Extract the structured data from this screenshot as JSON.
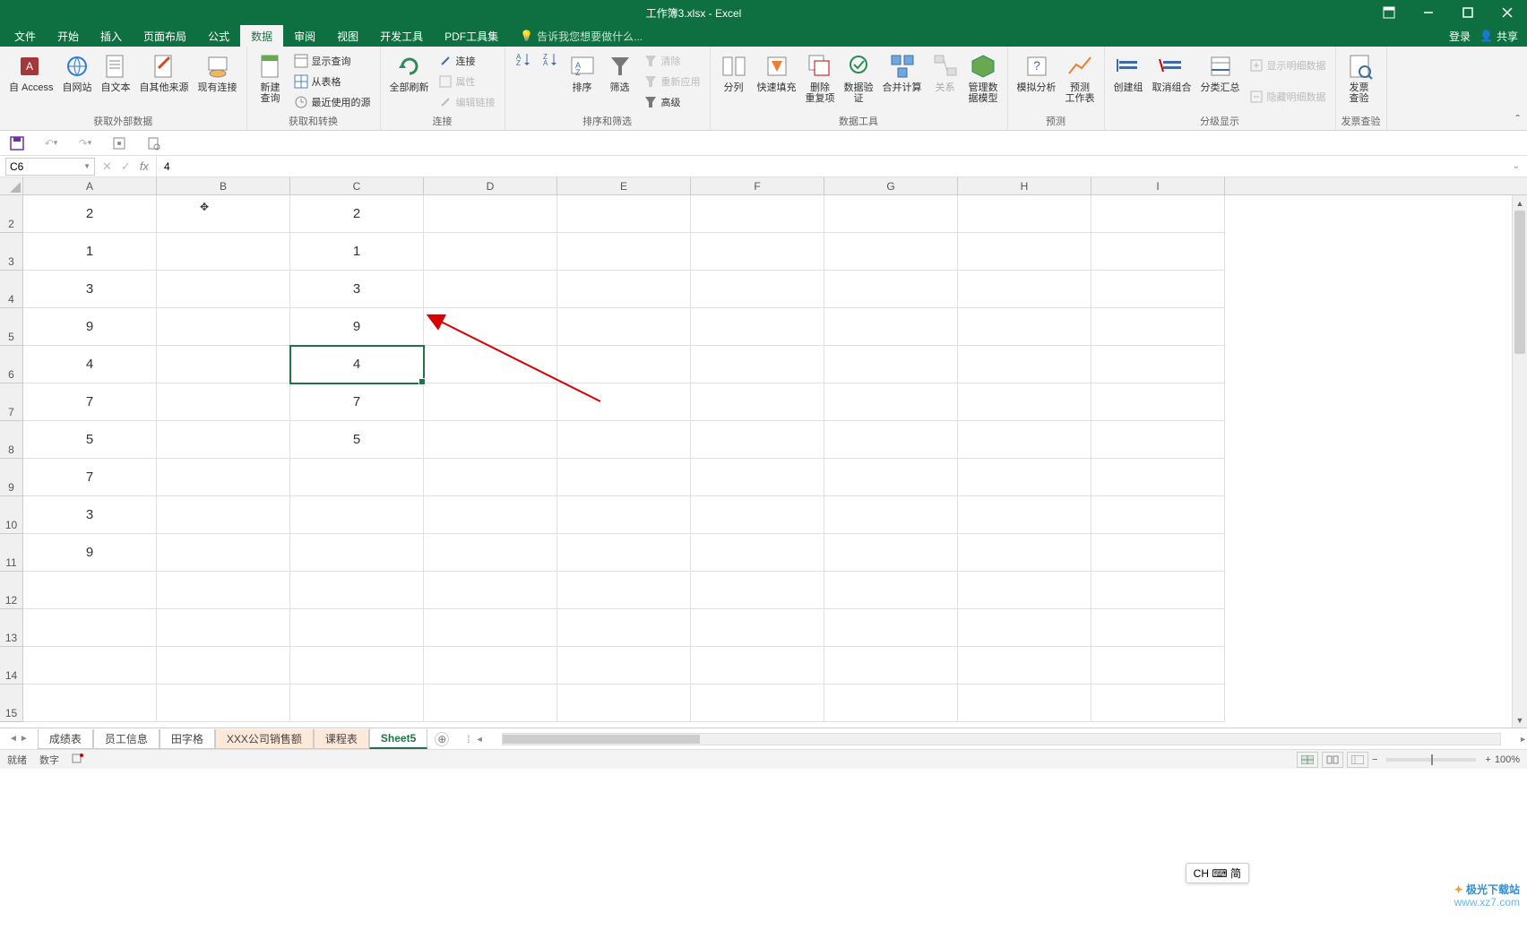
{
  "app": {
    "title": "工作簿3.xlsx - Excel"
  },
  "winctl": {
    "ribbonopts": "⧉",
    "min": "—",
    "max": "□",
    "close": "✕"
  },
  "menu": {
    "tabs": [
      "文件",
      "开始",
      "插入",
      "页面布局",
      "公式",
      "数据",
      "审阅",
      "视图",
      "开发工具",
      "PDF工具集"
    ],
    "active": 5,
    "tellme": "告诉我您想要做什么...",
    "login": "登录",
    "share": "共享"
  },
  "ribbon": {
    "groups": {
      "external": {
        "label": "获取外部数据",
        "access": "自 Access",
        "web": "自网站",
        "text": "自文本",
        "other": "自其他来源",
        "existing": "现有连接"
      },
      "transform": {
        "label": "获取和转换",
        "newq": "新建\n查询",
        "showq": "显示查询",
        "fromtable": "从表格",
        "recent": "最近使用的源"
      },
      "conn": {
        "label": "连接",
        "refresh": "全部刷新",
        "connections": "连接",
        "props": "属性",
        "editlinks": "编辑链接"
      },
      "sort": {
        "label": "排序和筛选",
        "sort": "排序",
        "filter": "筛选",
        "clear": "清除",
        "reapply": "重新应用",
        "adv": "高级"
      },
      "tools": {
        "label": "数据工具",
        "t2c": "分列",
        "flash": "快速填充",
        "dedup": "删除\n重复项",
        "validate": "数据验\n证",
        "consolidate": "合并计算",
        "relations": "关系",
        "manage": "管理数\n据模型"
      },
      "forecast": {
        "label": "预测",
        "whatif": "模拟分析",
        "sheet": "预测\n工作表"
      },
      "outline": {
        "label": "分级显示",
        "group": "创建组",
        "ungroup": "取消组合",
        "subtotal": "分类汇总",
        "showdetail": "显示明细数据",
        "hidedetail": "隐藏明细数据"
      },
      "invoice": {
        "label": "发票查验",
        "btn": "发票\n查验"
      }
    }
  },
  "fbar": {
    "name": "C6",
    "value": "4"
  },
  "columns": [
    "A",
    "B",
    "C",
    "D",
    "E",
    "F",
    "G",
    "H",
    "I"
  ],
  "rows": [
    {
      "n": "2",
      "A": "2",
      "C": "2"
    },
    {
      "n": "3",
      "A": "1",
      "C": "1"
    },
    {
      "n": "4",
      "A": "3",
      "C": "3"
    },
    {
      "n": "5",
      "A": "9",
      "C": "9"
    },
    {
      "n": "6",
      "A": "4",
      "C": "4"
    },
    {
      "n": "7",
      "A": "7",
      "C": "7"
    },
    {
      "n": "8",
      "A": "5",
      "C": "5"
    },
    {
      "n": "9",
      "A": "7",
      "C": ""
    },
    {
      "n": "10",
      "A": "3",
      "C": ""
    },
    {
      "n": "11",
      "A": "9",
      "C": ""
    },
    {
      "n": "12",
      "A": "",
      "C": ""
    },
    {
      "n": "13",
      "A": "",
      "C": ""
    },
    {
      "n": "14",
      "A": "",
      "C": ""
    },
    {
      "n": "15",
      "A": "",
      "C": ""
    }
  ],
  "selected": {
    "row": 4,
    "col": 2
  },
  "sheets": {
    "items": [
      "成绩表",
      "员工信息",
      "田字格",
      "XXX公司销售额",
      "课程表",
      "Sheet5"
    ],
    "active": 5,
    "hl": [
      3,
      4
    ]
  },
  "status": {
    "ready": "就绪",
    "num": "数字",
    "zoom": "100%"
  },
  "ime": "CH ⌨ 简",
  "watermark": {
    "a": "极光下载站",
    "b": "www.xz7.com"
  }
}
